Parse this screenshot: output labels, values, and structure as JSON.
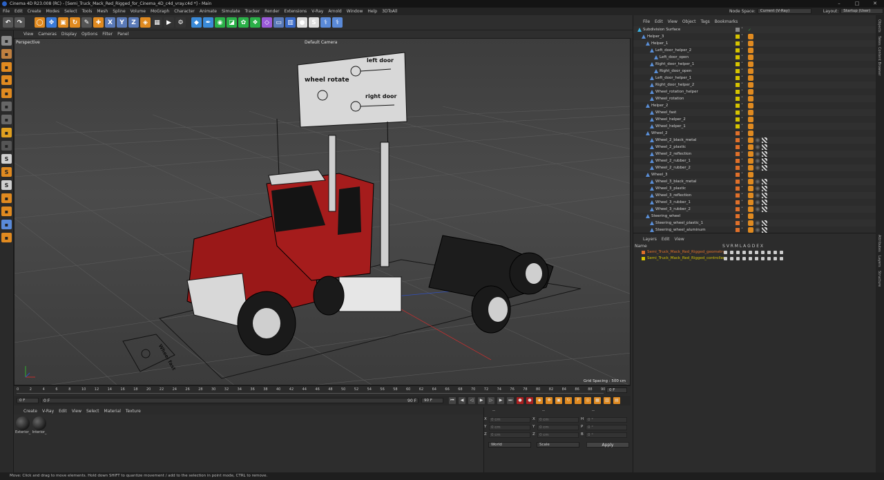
{
  "title": "Cinema 4D R23.008 (RC) - [Semi_Truck_Mack_Red_Rigged_for_Cinema_4D_c4d_vray.c4d *] - Main",
  "menu": [
    "File",
    "Edit",
    "Create",
    "Modes",
    "Select",
    "Tools",
    "Mesh",
    "Spline",
    "Volume",
    "MoGraph",
    "Character",
    "Animate",
    "Simulate",
    "Tracker",
    "Render",
    "Extensions",
    "V-Ray",
    "Arnold",
    "Window",
    "Help",
    "3DToAll"
  ],
  "node_space": {
    "label": "Node Space:",
    "value": "Current (V-Ray)"
  },
  "layout": {
    "label": "Layout:",
    "value": "Startup (User)"
  },
  "toolbar_icons": [
    "undo-icon",
    "redo-icon",
    "live-selection-icon",
    "move-icon",
    "scale-icon",
    "rotate-icon",
    "recent-tools-icon",
    "coordinate-icon",
    "x-axis-icon",
    "y-axis-icon",
    "z-axis-icon",
    "world-coordinate-icon",
    "render-view-icon",
    "render-picture-icon",
    "render-settings-icon",
    "cube-icon",
    "pen-icon",
    "subdivision-icon",
    "extrude-icon",
    "cloner-icon",
    "mograph-icon",
    "deformer-icon",
    "floor-icon",
    "camera-icon",
    "light-icon",
    "vray-icon",
    "python-icon",
    "plugin-icon"
  ],
  "viewport": {
    "menu": [
      "View",
      "Cameras",
      "Display",
      "Options",
      "Filter",
      "Panel"
    ],
    "label": "Perspective",
    "camera": "Default Camera",
    "grid": "Grid Spacing : 500 cm",
    "controller": {
      "left_door": "left door",
      "right_door": "right door",
      "wheel_rotate": "wheel rotate"
    },
    "floor_text": "Wheel fast"
  },
  "timeline": {
    "ticks": [
      "0",
      "2",
      "4",
      "6",
      "8",
      "10",
      "12",
      "14",
      "16",
      "18",
      "20",
      "22",
      "24",
      "26",
      "28",
      "30",
      "32",
      "34",
      "36",
      "38",
      "40",
      "42",
      "44",
      "46",
      "48",
      "50",
      "52",
      "54",
      "56",
      "58",
      "60",
      "62",
      "64",
      "66",
      "68",
      "70",
      "72",
      "74",
      "76",
      "78",
      "80",
      "82",
      "84",
      "86",
      "88",
      "90"
    ],
    "current": "0 F"
  },
  "playbar": {
    "start": "0 F",
    "min": "0 F",
    "max": "90 F",
    "end": "90 F"
  },
  "materials": {
    "menu": [
      "Create",
      "V-Ray",
      "Edit",
      "View",
      "Select",
      "Material",
      "Texture"
    ],
    "items": [
      "Exterior_",
      "Interior_"
    ]
  },
  "coords": {
    "header": [
      "--",
      "--",
      "--"
    ],
    "rows": [
      {
        "a": "X",
        "av": "0 cm",
        "b": "X",
        "bv": "0 cm",
        "c": "H",
        "cv": "0 °"
      },
      {
        "a": "Y",
        "av": "0 cm",
        "b": "Y",
        "bv": "0 cm",
        "c": "P",
        "cv": "0 °"
      },
      {
        "a": "Z",
        "av": "0 cm",
        "b": "Z",
        "bv": "0 cm",
        "c": "B",
        "cv": "0 °"
      }
    ],
    "mode1": "World",
    "mode2": "Scale",
    "apply": "Apply"
  },
  "objects": {
    "menu": [
      "File",
      "Edit",
      "View",
      "Object",
      "Tags",
      "Bookmarks"
    ],
    "items": [
      {
        "name": "Subdivision Surface",
        "indent": 0,
        "color": "#888888"
      },
      {
        "name": "Helper_3",
        "indent": 1,
        "color": "#d6c400"
      },
      {
        "name": "Helper_1",
        "indent": 2,
        "color": "#d6c400"
      },
      {
        "name": "Left_door_helper_2",
        "indent": 3,
        "color": "#d6c400"
      },
      {
        "name": "Left_door_open",
        "indent": 4,
        "color": "#d6c400"
      },
      {
        "name": "Right_door_helper_1",
        "indent": 3,
        "color": "#d6c400"
      },
      {
        "name": "Right_door_open",
        "indent": 4,
        "color": "#d6c400"
      },
      {
        "name": "Left_door_helper_1",
        "indent": 3,
        "color": "#d6c400"
      },
      {
        "name": "Right_door_helper_2",
        "indent": 3,
        "color": "#d6c400"
      },
      {
        "name": "Wheel_rotation_helper",
        "indent": 3,
        "color": "#d6c400"
      },
      {
        "name": "Wheel_rotation",
        "indent": 3,
        "color": "#d6c400"
      },
      {
        "name": "Helper_2",
        "indent": 2,
        "color": "#d6c400"
      },
      {
        "name": "Wheel_fast",
        "indent": 3,
        "color": "#d6c400"
      },
      {
        "name": "Wheel_helper_2",
        "indent": 3,
        "color": "#d6c400"
      },
      {
        "name": "Wheel_helper_1",
        "indent": 3,
        "color": "#d6c400"
      },
      {
        "name": "Wheel_2",
        "indent": 2,
        "color": "#e0702a"
      },
      {
        "name": "Wheel_2_black_metal",
        "indent": 3,
        "color": "#e0702a"
      },
      {
        "name": "Wheel_2_plastic",
        "indent": 3,
        "color": "#e0702a"
      },
      {
        "name": "Wheel_2_reflection",
        "indent": 3,
        "color": "#e0702a"
      },
      {
        "name": "Wheel_2_rubber_1",
        "indent": 3,
        "color": "#e0702a"
      },
      {
        "name": "Wheel_2_rubber_2",
        "indent": 3,
        "color": "#e0702a"
      },
      {
        "name": "Wheel_3",
        "indent": 2,
        "color": "#e0702a"
      },
      {
        "name": "Wheel_3_black_metal",
        "indent": 3,
        "color": "#e0702a"
      },
      {
        "name": "Wheel_3_plastic",
        "indent": 3,
        "color": "#e0702a"
      },
      {
        "name": "Wheel_3_reflection",
        "indent": 3,
        "color": "#e0702a"
      },
      {
        "name": "Wheel_3_rubber_1",
        "indent": 3,
        "color": "#e0702a"
      },
      {
        "name": "Wheel_3_rubber_2",
        "indent": 3,
        "color": "#e0702a"
      },
      {
        "name": "Steering_wheel",
        "indent": 2,
        "color": "#e0702a"
      },
      {
        "name": "Steering_wheel_plastic_1",
        "indent": 3,
        "color": "#e0702a"
      },
      {
        "name": "Steering_wheel_aluminum",
        "indent": 3,
        "color": "#e0702a"
      }
    ]
  },
  "layers": {
    "menu": [
      "Layers",
      "Edit",
      "View"
    ],
    "header_name": "Name",
    "header_flags": "S V R M L A G D E X",
    "items": [
      {
        "name": "Semi_Truck_Mack_Red_Rigged_geometry",
        "color": "#e0702a"
      },
      {
        "name": "Semi_Truck_Mack_Red_Rigged_controllers",
        "color": "#d6c400"
      }
    ]
  },
  "side_tabs": [
    "Objects",
    "Takes",
    "Content Browser",
    "Attributes",
    "Layers",
    "Structure"
  ],
  "status": "Move: Click and drag to move elements. Hold down SHIFT to quantize movement / add to the selection in point mode, CTRL to remove."
}
